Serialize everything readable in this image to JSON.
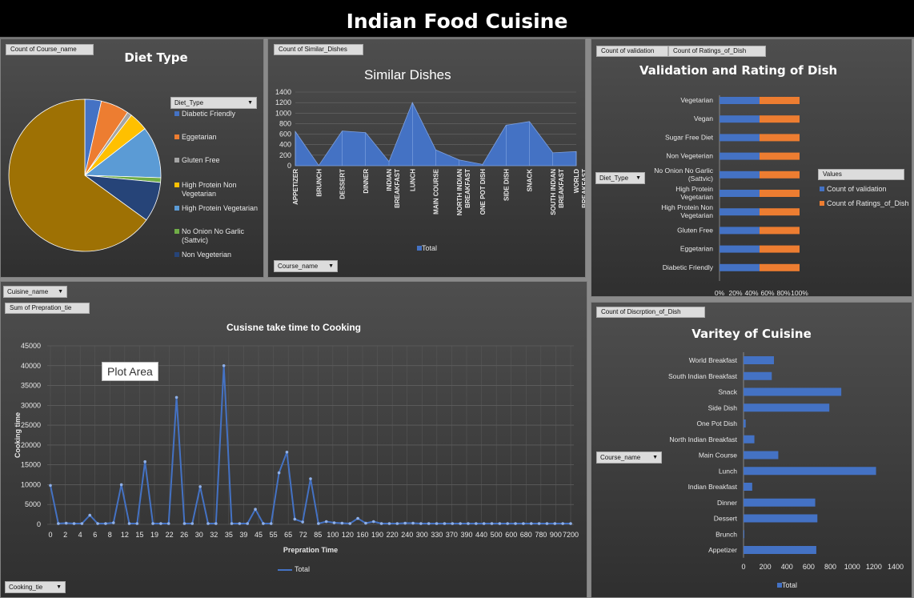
{
  "dashboard_title": "Indian Food Cuisine",
  "colors": {
    "blue": "#4472c4",
    "orange": "#ed7d31"
  },
  "pie_panel": {
    "field_button": "Count of Course_name",
    "filter_button": "Diet_Type",
    "legend_items": [
      "Diabetic Friendly",
      "Eggetarian",
      "Gluten Free",
      "High Protein Non Vegetarian",
      "High Protein Vegetarian",
      "No Onion No Garlic (Sattvic)",
      "Non Vegeterian"
    ],
    "legend_colors": [
      "#4472c4",
      "#ed7d31",
      "#a5a5a5",
      "#ffc000",
      "#5b9bd5",
      "#70ad47",
      "#264478"
    ]
  },
  "area_panel": {
    "field_button": "Count of Similar_Dishes",
    "filter_button": "Course_name",
    "legend": "Total"
  },
  "validation_panel": {
    "field_buttons": [
      "Count of validation",
      "Count of Ratings_of_Dish"
    ],
    "filter_button": "Diet_Type",
    "values_header": "Values",
    "legend": [
      "Count of validation",
      "Count of Ratings_of_Dish"
    ]
  },
  "line_panel": {
    "filter_button": "Cuisine_name",
    "field_button": "Sum of Prepration_tie",
    "axis_button": "Cooking_tie",
    "plot_area_label": "Plot Area",
    "legend": "Total"
  },
  "variety_panel": {
    "field_button": "Count of Discrption_of_Dish",
    "filter_button": "Course_name",
    "legend": "Total"
  },
  "chart_data": [
    {
      "type": "pie",
      "title": "Diet Type",
      "categories": [
        "Diabetic Friendly",
        "Eggetarian",
        "Gluten Free",
        "High Protein Non Vegetarian",
        "High Protein Vegetarian",
        "No Onion No Garlic (Sattvic)",
        "Non Vegeterian",
        "Vegetarian"
      ],
      "values": [
        3.5,
        6,
        1,
        4,
        11,
        1,
        8.5,
        65
      ],
      "colors": [
        "#4472c4",
        "#ed7d31",
        "#a5a5a5",
        "#ffc000",
        "#5b9bd5",
        "#70ad47",
        "#264478",
        "#9e7104"
      ]
    },
    {
      "type": "area",
      "title": "Similar Dishes",
      "categories": [
        "APPETIZER",
        "BRUNCH",
        "DESSERT",
        "DINNER",
        "INDIAN BREAKFAST",
        "LUNCH",
        "MAIN COURSE",
        "NORTH INDIAN BREAKFAST",
        "ONE POT DISH",
        "SIDE DISH",
        "SNACK",
        "SOUTH INDIAN BREAKFAST",
        "WORLD BREAKFAST"
      ],
      "values": [
        650,
        5,
        660,
        630,
        80,
        1200,
        300,
        110,
        25,
        770,
        840,
        245,
        270
      ],
      "ylim": [
        0,
        1400
      ],
      "yticks": [
        0,
        200,
        400,
        600,
        800,
        1000,
        1200,
        1400
      ],
      "series_name": "Total"
    },
    {
      "type": "bar",
      "stacked": "100%",
      "title": "Validation and Rating of Dish",
      "categories": [
        "Vegetarian",
        "Vegan",
        "Sugar Free Diet",
        "Non Vegeterian",
        "No Onion No Garlic (Sattvic)",
        "High Protein Vegetarian",
        "High Protein Non Vegetarian",
        "Gluten Free",
        "Eggetarian",
        "Diabetic Friendly"
      ],
      "series": [
        {
          "name": "Count of validation",
          "values": [
            50,
            50,
            50,
            50,
            50,
            50,
            50,
            50,
            50,
            50
          ]
        },
        {
          "name": "Count of Ratings_of_Dish",
          "values": [
            50,
            50,
            50,
            50,
            50,
            50,
            50,
            50,
            50,
            50
          ]
        }
      ],
      "xticks": [
        "0%",
        "20%",
        "40%",
        "60%",
        "80%",
        "100%"
      ]
    },
    {
      "type": "line",
      "title": "Cusisne take time to Cooking",
      "xlabel": "Prepration Time",
      "ylabel": "Cooking time",
      "x": [
        "0",
        "1",
        "2",
        "3",
        "4",
        "5",
        "6",
        "7",
        "8",
        "10",
        "12",
        "15",
        "18",
        "19",
        "20",
        "22",
        "25",
        "26",
        "28",
        "30",
        "31",
        "32",
        "34",
        "35",
        "38",
        "39",
        "45",
        "50",
        "55",
        "60",
        "65",
        "70",
        "72",
        "80",
        "85",
        "90",
        "100",
        "110",
        "120",
        "140",
        "160",
        "170",
        "190",
        "200",
        "220",
        "225",
        "240",
        "260",
        "300",
        "320",
        "330",
        "360",
        "370",
        "390",
        "420",
        "440",
        "480",
        "500",
        "520",
        "600",
        "660",
        "720",
        "780",
        "800",
        "840",
        "900",
        "7200"
      ],
      "x_tick_labels": [
        "0",
        "2",
        "4",
        "6",
        "8",
        "12",
        "15",
        "19",
        "22",
        "26",
        "30",
        "32",
        "35",
        "39",
        "45",
        "55",
        "65",
        "72",
        "85",
        "100",
        "120",
        "160",
        "190",
        "220",
        "240",
        "300",
        "330",
        "370",
        "390",
        "440",
        "500",
        "600",
        "680",
        "780",
        "900",
        "7200"
      ],
      "values": [
        9800,
        200,
        300,
        200,
        200,
        2300,
        200,
        200,
        400,
        10000,
        200,
        200,
        15800,
        200,
        200,
        200,
        32000,
        200,
        200,
        9500,
        200,
        200,
        40000,
        200,
        200,
        200,
        3800,
        200,
        200,
        13000,
        18200,
        1300,
        600,
        11500,
        200,
        700,
        400,
        300,
        200,
        1500,
        300,
        700,
        200,
        200,
        200,
        300,
        300,
        200,
        200,
        200,
        200,
        200,
        200,
        200,
        200,
        200,
        200,
        200,
        200,
        200,
        200,
        200,
        200,
        200,
        200,
        200,
        200
      ],
      "ylim": [
        0,
        45000
      ],
      "yticks": [
        0,
        5000,
        10000,
        15000,
        20000,
        25000,
        30000,
        35000,
        40000,
        45000
      ],
      "series_name": "Total"
    },
    {
      "type": "bar",
      "orientation": "horizontal",
      "title": "Varitey of Cuisine",
      "categories": [
        "World Breakfast",
        "South Indian Breakfast",
        "Snack",
        "Side Dish",
        "One Pot Dish",
        "North Indian Breakfast",
        "Main Course",
        "Lunch",
        "Indian Breakfast",
        "Dinner",
        "Dessert",
        "Brunch",
        "Appetizer"
      ],
      "values": [
        280,
        260,
        900,
        790,
        20,
        100,
        320,
        1220,
        80,
        660,
        680,
        5,
        670
      ],
      "xlim": [
        0,
        1400
      ],
      "xticks": [
        0,
        200,
        400,
        600,
        800,
        1000,
        1200,
        1400
      ],
      "series_name": "Total"
    }
  ]
}
